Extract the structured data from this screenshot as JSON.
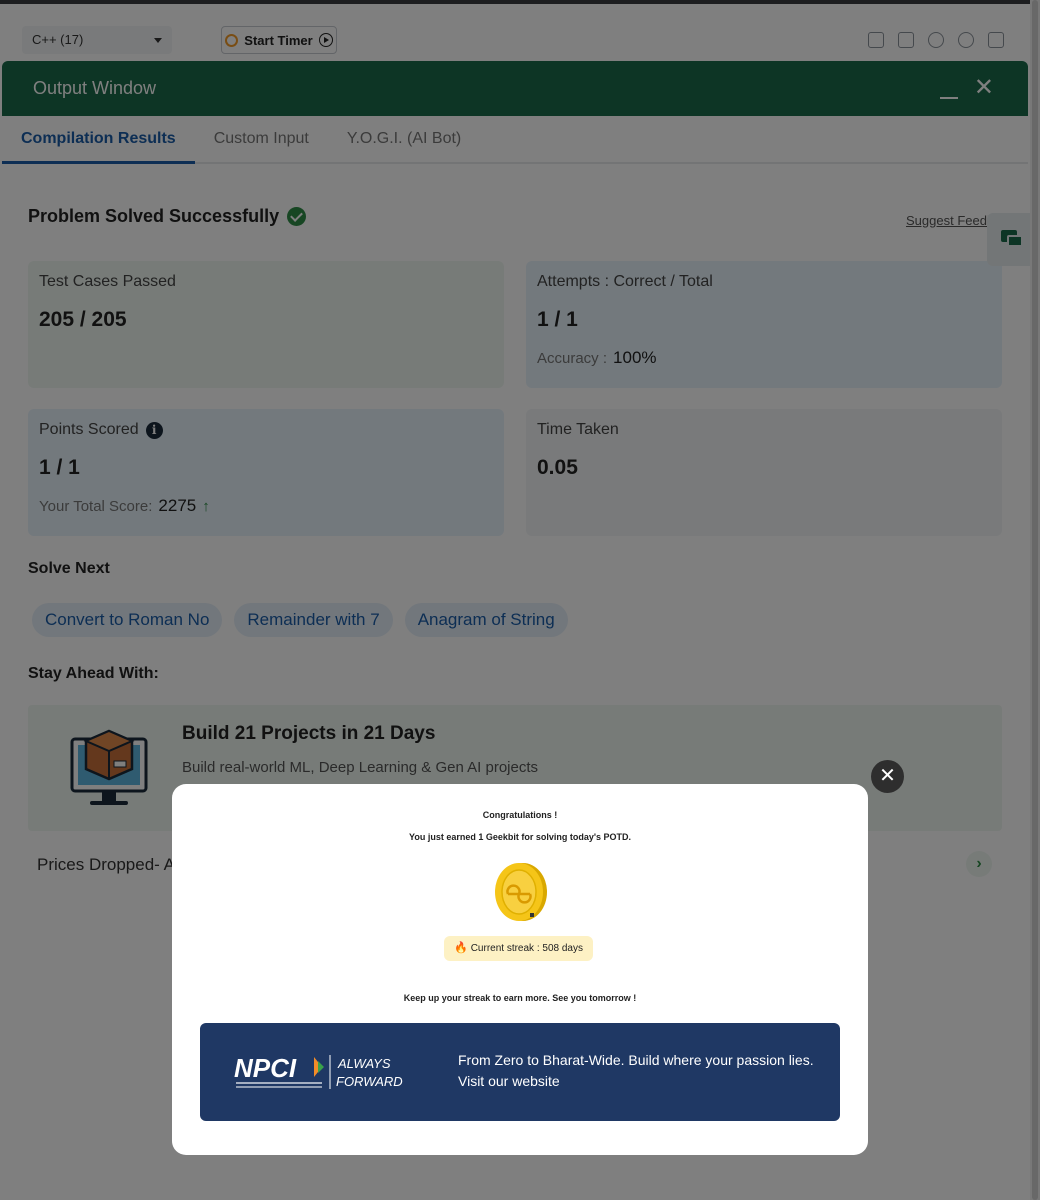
{
  "editor": {
    "language": "C++ (17)",
    "timer_label": "Start Timer"
  },
  "output_window": {
    "title": "Output Window",
    "tabs": [
      "Compilation Results",
      "Custom Input",
      "Y.O.G.I. (AI Bot)"
    ],
    "status": "Problem Solved Successfully",
    "suggest_feedback": "Suggest Feedback",
    "cards": {
      "test_cases": {
        "label": "Test Cases Passed",
        "value": "205 / 205"
      },
      "attempts": {
        "label": "Attempts : Correct / Total",
        "value": "1 / 1",
        "sub_label": "Accuracy :",
        "sub_value": "100%"
      },
      "points": {
        "label": "Points Scored",
        "value": "1 / 1",
        "sub_label": "Your Total Score:",
        "sub_value": "2275"
      },
      "time": {
        "label": "Time Taken",
        "value": "0.05"
      }
    },
    "solve_next": {
      "title": "Solve Next",
      "items": [
        "Convert to Roman No",
        "Remainder with 7",
        "Anagram of String"
      ]
    },
    "stay_ahead": {
      "title": "Stay Ahead With:",
      "promo_title": "Build 21 Projects in 21 Days",
      "promo_sub": "Build real-world ML, Deep Learning & Gen AI projects"
    },
    "prices_row": "Prices Dropped- A"
  },
  "modal": {
    "title": "Congratulations !",
    "subtitle": "You just earned 1 Geekbit for solving today's POTD.",
    "streak": "Current streak : 508 days",
    "keep_up": "Keep up your streak to earn more. See you tomorrow !",
    "ad": {
      "logo_text": "NPCI",
      "tagline_1": "ALWAYS",
      "tagline_2": "FORWARD",
      "text": "From Zero to Bharat-Wide. Build where your passion lies. Visit our website"
    }
  },
  "colors": {
    "header_green": "#1b6b4a",
    "active_tab": "#1a5da8",
    "success": "#2f8d46",
    "ad_navy": "#1f3864"
  }
}
